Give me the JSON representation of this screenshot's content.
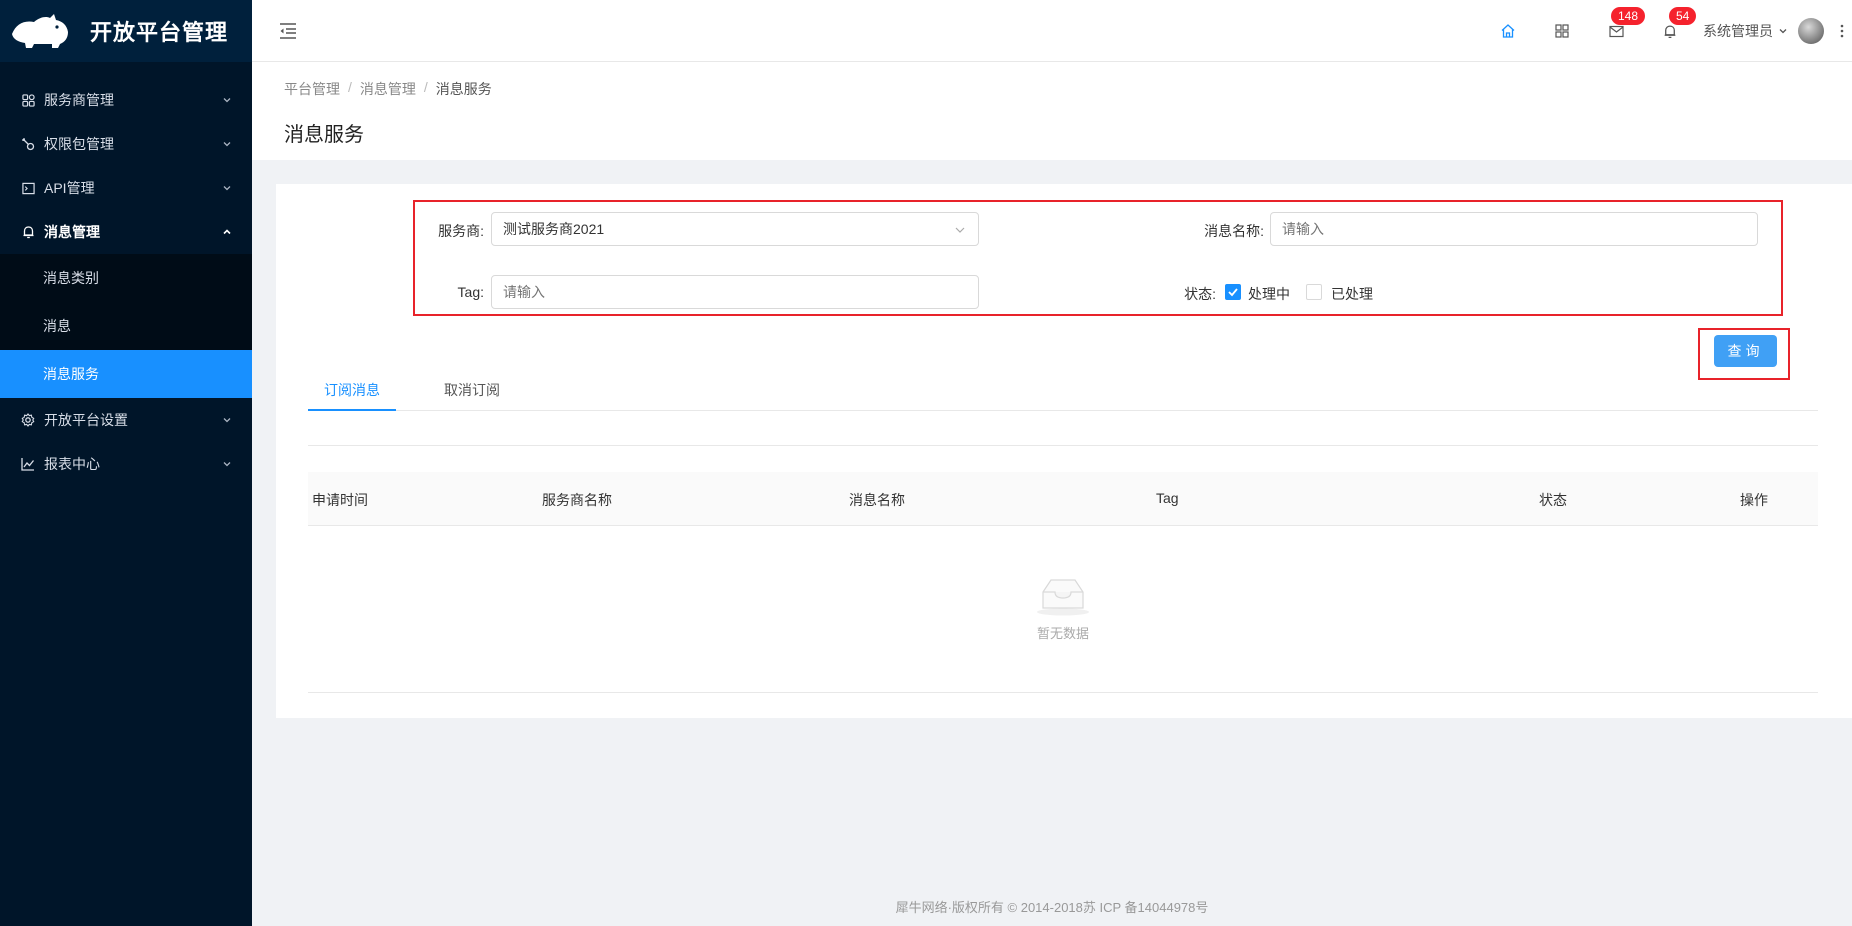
{
  "app": {
    "title": "开放平台管理"
  },
  "sidebar": {
    "items": [
      {
        "label": "服务商管理",
        "icon": "group-icon"
      },
      {
        "label": "权限包管理",
        "icon": "key-icon"
      },
      {
        "label": "API管理",
        "icon": "code-icon"
      },
      {
        "label": "消息管理",
        "icon": "bell-icon",
        "open": true,
        "children": [
          {
            "label": "消息类别"
          },
          {
            "label": "消息"
          },
          {
            "label": "消息服务",
            "active": true
          }
        ]
      },
      {
        "label": "开放平台设置",
        "icon": "gear-icon"
      },
      {
        "label": "报表中心",
        "icon": "chart-icon"
      }
    ]
  },
  "header": {
    "mail_badge": "148",
    "bell_badge": "54",
    "user_name": "系统管理员"
  },
  "breadcrumb": {
    "items": [
      "平台管理",
      "消息管理",
      "消息服务"
    ],
    "separator": "/"
  },
  "page_title": "消息服务",
  "filters": {
    "provider_label": "服务商:",
    "provider_value": "测试服务商2021",
    "message_name_label": "消息名称:",
    "message_name_placeholder": "请输入",
    "tag_label": "Tag:",
    "tag_placeholder": "请输入",
    "status_label": "状态:",
    "status_options": [
      {
        "label": "处理中",
        "checked": true
      },
      {
        "label": "已处理",
        "checked": false
      }
    ],
    "query_button": "查询"
  },
  "tabs": [
    {
      "label": "订阅消息",
      "active": true
    },
    {
      "label": "取消订阅",
      "active": false
    }
  ],
  "table": {
    "columns": [
      "申请时间",
      "服务商名称",
      "消息名称",
      "Tag",
      "状态",
      "操作"
    ],
    "empty_text": "暂无数据"
  },
  "footer": "犀牛网络·版权所有 © 2014-2018苏 ICP 备14044978号",
  "colors": {
    "sidebar_bg": "#001529",
    "primary": "#1890ff",
    "highlight_box": "#e8232a",
    "badge": "#f5222d"
  }
}
